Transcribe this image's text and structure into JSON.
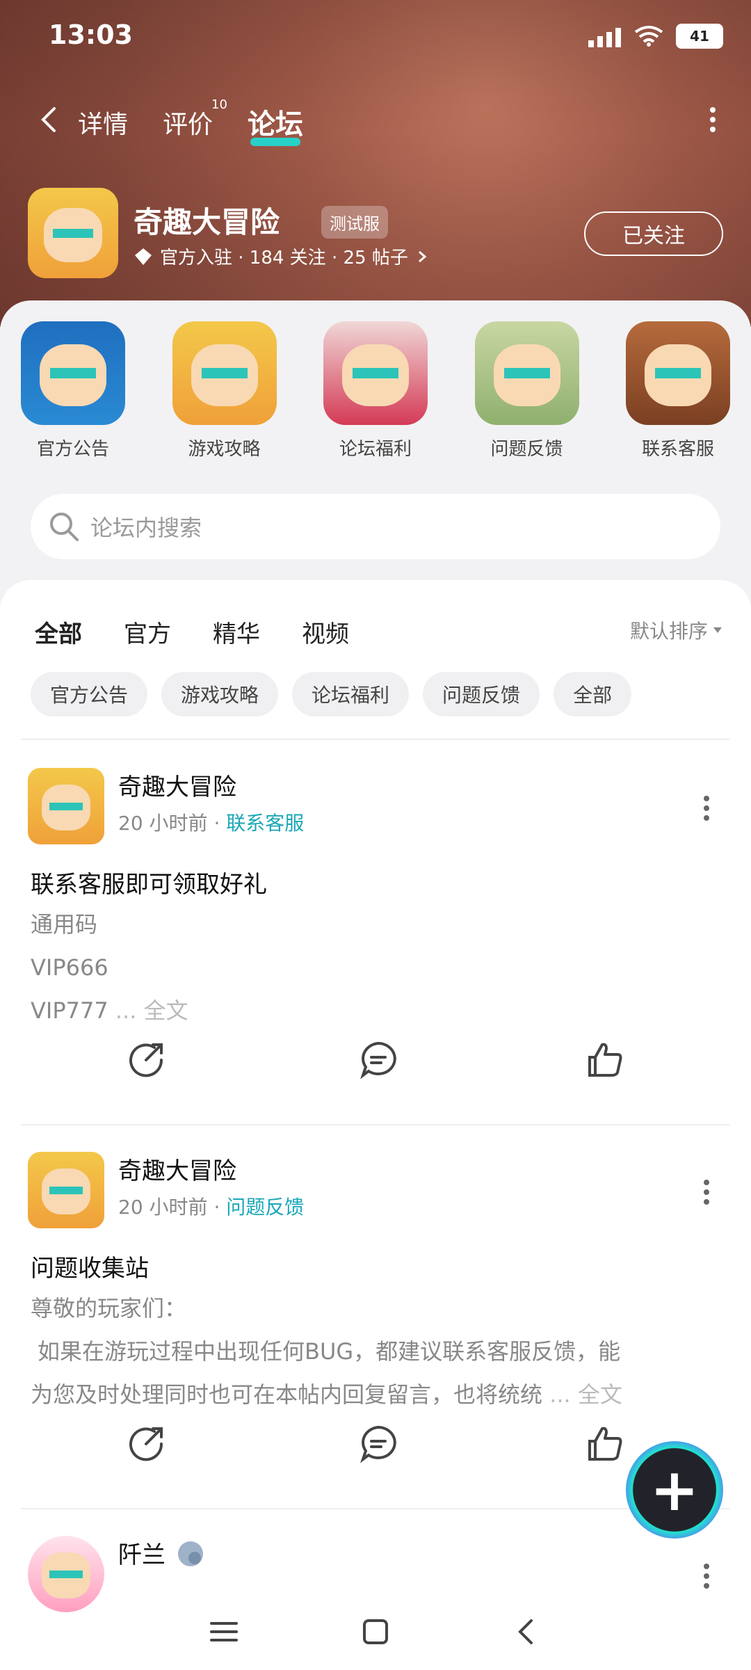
{
  "status": {
    "time": "13:03",
    "battery": "41"
  },
  "nav": {
    "tabs": [
      {
        "label": "详情"
      },
      {
        "label": "评价"
      },
      {
        "label": "论坛"
      }
    ],
    "review_count": "10"
  },
  "game": {
    "name": "奇趣大冒险",
    "tag": "测试服",
    "meta": "官方入驻 · 184 关注 · 25 帖子",
    "follow_label": "已关注"
  },
  "shortcuts": [
    {
      "label": "官方公告",
      "icon": "pirate-icon"
    },
    {
      "label": "游戏攻略",
      "icon": "game-avatar-icon"
    },
    {
      "label": "论坛福利",
      "icon": "dino-icon"
    },
    {
      "label": "问题反馈",
      "icon": "statue-icon"
    },
    {
      "label": "联系客服",
      "icon": "cowboy-icon"
    }
  ],
  "search": {
    "placeholder": "论坛内搜索"
  },
  "feed": {
    "tabs": [
      {
        "label": "全部"
      },
      {
        "label": "官方"
      },
      {
        "label": "精华"
      },
      {
        "label": "视频"
      }
    ],
    "sort": "默认排序",
    "chips": [
      {
        "label": "官方公告"
      },
      {
        "label": "游戏攻略"
      },
      {
        "label": "论坛福利"
      },
      {
        "label": "问题反馈"
      },
      {
        "label": "全部"
      }
    ]
  },
  "posts": [
    {
      "author": "奇趣大冒险",
      "time": "20 小时前",
      "category": "联系客服",
      "title": "联系客服即可领取好礼",
      "lines": [
        "通用码",
        "VIP666",
        "VIP777"
      ],
      "more": "... 全文"
    },
    {
      "author": "奇趣大冒险",
      "time": "20 小时前",
      "category": "问题反馈",
      "title": "问题收集站",
      "lines": [
        "尊敬的玩家们：",
        "如果在游玩过程中出现任何BUG，都建议联系客服反馈，能",
        "为您及时处理同时也可在本帖内回复留言，也将统统"
      ],
      "more": "... 全文"
    },
    {
      "author": "阡兰"
    }
  ],
  "colors": {
    "accent": "#28d1c7",
    "category": "#1aa7b7"
  }
}
